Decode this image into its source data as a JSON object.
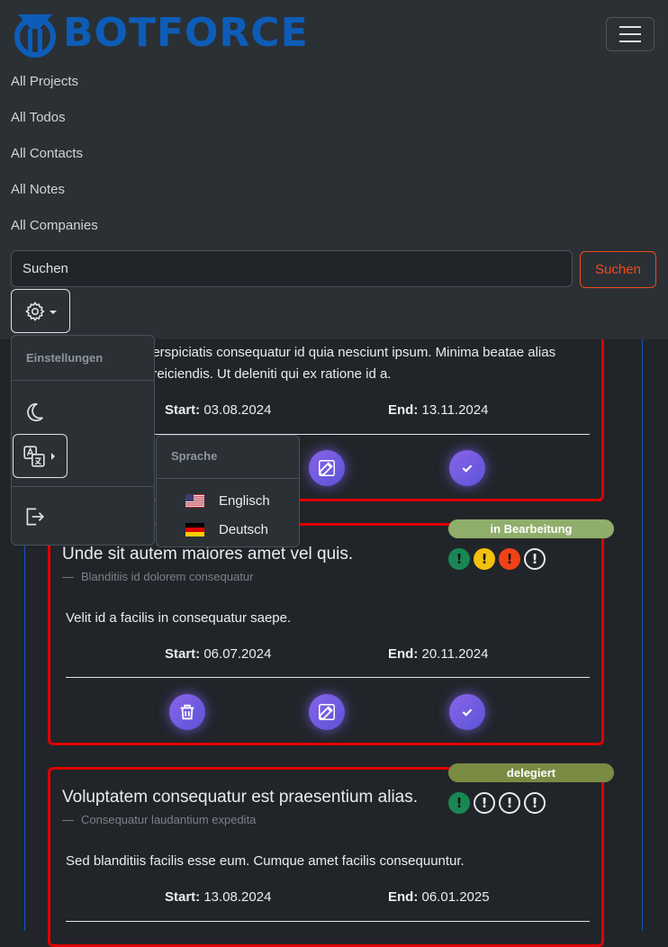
{
  "brand": {
    "name": "BOTFORCE"
  },
  "nav": {
    "links": [
      "All Projects",
      "All Todos",
      "All Contacts",
      "All Notes",
      "All Companies"
    ]
  },
  "search": {
    "placeholder": "Suchen",
    "button_label": "Suchen"
  },
  "settings_menu": {
    "header": "Einstellungen",
    "items": [
      "moon-icon",
      "translate-icon",
      "logout-icon"
    ]
  },
  "language_menu": {
    "header": "Sprache",
    "options": [
      {
        "label": "Englisch",
        "flag": "us-flag"
      },
      {
        "label": "Deutsch",
        "flag": "de-flag"
      }
    ]
  },
  "cards": [
    {
      "description_partial": "perspiciatis consequatur id quia nesciunt ipsum. Minima beatae alias",
      "description_partial_2": "t reiciendis. Ut deleniti qui ex ratione id a.",
      "start_label": "Start:",
      "start": "03.08.2024",
      "end_label": "End:",
      "end": "13.11.2024"
    },
    {
      "title": "Unde sit autem maiores amet vel quis.",
      "subtitle_dash": "—",
      "subtitle": "Blanditiis id dolorem consequatur",
      "status": "in Bearbeitung",
      "status_color": "#8fae6b",
      "description": "Velit id a facilis in consequatur saepe.",
      "start_label": "Start:",
      "start": "06.07.2024",
      "end_label": "End:",
      "end": "20.11.2024"
    },
    {
      "title": "Voluptatem consequatur est praesentium alias.",
      "subtitle_dash": "—",
      "subtitle": "Consequatur laudantium expedita",
      "status": "delegiert",
      "status_color": "#7a8b44",
      "description": "Sed blanditiis facilis esse eum. Cumque amet facilis consequuntur.",
      "start_label": "Start:",
      "start": "13.08.2024",
      "end_label": "End:",
      "end": "06.01.2025"
    }
  ],
  "colors": {
    "accent_red": "#e00000",
    "search_button": "#f04a1c",
    "action_button": "#7b5cf0",
    "brand_blue": "#0d5db8"
  }
}
